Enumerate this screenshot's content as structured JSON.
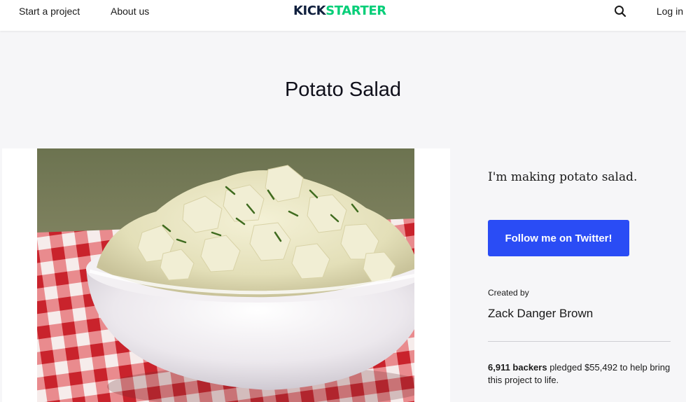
{
  "header": {
    "start_project": "Start a project",
    "about": "About us",
    "logo_part1": "KICK",
    "logo_part2": "STARTER",
    "login": "Log in"
  },
  "project": {
    "title": "Potato Salad",
    "blurb": "I'm making potato salad.",
    "follow_button": "Follow me on Twitter!",
    "created_by_label": "Created by",
    "creator": "Zack Danger Brown",
    "backers_count": "6,911 backers",
    "pledged_text": " pledged $55,492 to help bring this project to life."
  },
  "colors": {
    "brand_green": "#05ce78",
    "brand_navy": "#0f1f3d",
    "follow_button_bg": "#2a4cf5",
    "page_bg": "#f6f6f8"
  },
  "icons": {
    "search": "search-icon"
  }
}
